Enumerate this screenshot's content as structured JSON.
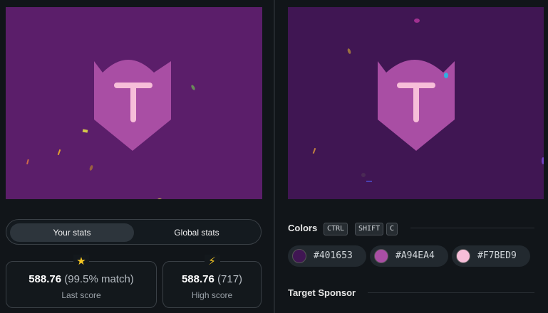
{
  "colors": {
    "dark": "#401653",
    "mid": "#A94EA4",
    "light": "#F7BED9",
    "left_canvas_bg": "#5b1e6a"
  },
  "stats": {
    "toggle": {
      "your_stats": "Your stats",
      "global_stats": "Global stats"
    },
    "last_score": {
      "value": "588.76",
      "match": "(99.5% match)",
      "label": "Last score"
    },
    "high_score": {
      "value": "588.76",
      "count": "(717)",
      "label": "High score"
    }
  },
  "colors_section": {
    "title": "Colors",
    "shortcut": [
      "CTRL",
      "SHIFT",
      "C"
    ],
    "swatches": [
      {
        "hex": "#401653"
      },
      {
        "hex": "#A94EA4"
      },
      {
        "hex": "#F7BED9"
      }
    ]
  },
  "sponsor_section": {
    "title": "Target Sponsor"
  },
  "icons": {
    "last_score": "star-icon",
    "high_score": "lightning-icon"
  }
}
